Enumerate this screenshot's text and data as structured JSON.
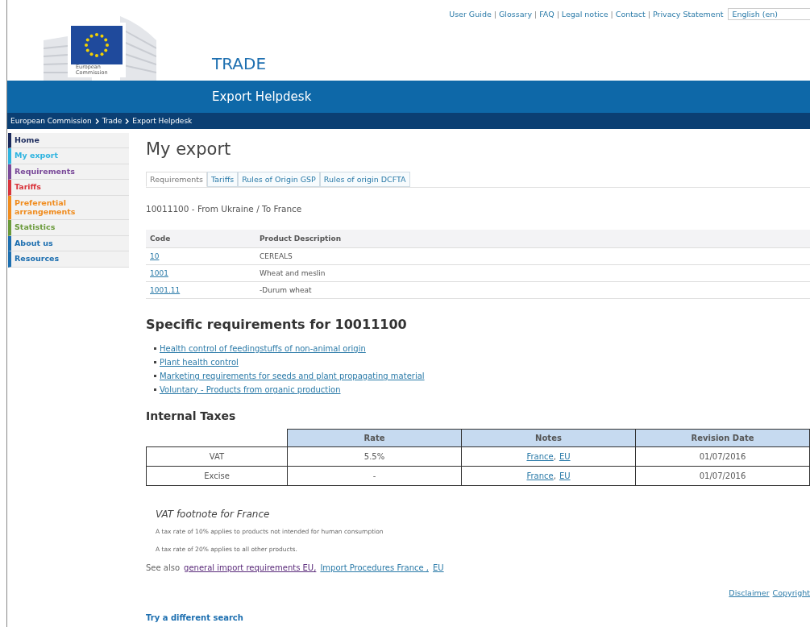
{
  "top_links": [
    "User Guide",
    "Glossary",
    "FAQ",
    "Legal notice",
    "Contact",
    "Privacy Statement"
  ],
  "top_link_separator": "|",
  "language": {
    "value": "English (en)"
  },
  "logo": {
    "caption": "European Commission"
  },
  "site": {
    "title": "TRADE",
    "subtitle": "Export Helpdesk"
  },
  "breadcrumb": [
    "European Commission",
    "Trade",
    "Export Helpdesk"
  ],
  "sidebar": {
    "items": [
      {
        "label": "Home",
        "color": "#1b2a5c"
      },
      {
        "label": "My export",
        "color": "#2fb4e0"
      },
      {
        "label": "Requirements",
        "color": "#7a4a9a"
      },
      {
        "label": "Tariffs",
        "color": "#d9343c"
      },
      {
        "label": "Preferential arrangements",
        "color": "#f08c1e"
      },
      {
        "label": "Statistics",
        "color": "#6a9a3a"
      },
      {
        "label": "About us",
        "color": "#1d6fb0"
      },
      {
        "label": "Resources",
        "color": "#1d6fb0"
      }
    ]
  },
  "page": {
    "title": "My export"
  },
  "tabs": [
    {
      "label": "Requirements",
      "selected": true
    },
    {
      "label": "Tariffs",
      "selected": false
    },
    {
      "label": "Rules of Origin GSP",
      "selected": false
    },
    {
      "label": "Rules of origin DCFTA",
      "selected": false
    }
  ],
  "route": "10011100 - From Ukraine / To France",
  "product_table": {
    "columns": [
      "Code",
      "Product Description"
    ],
    "rows": [
      {
        "code": "10",
        "description": "CEREALS"
      },
      {
        "code": "1001",
        "description": "Wheat and meslin"
      },
      {
        "code": "1001.11",
        "description": "-Durum wheat"
      }
    ]
  },
  "requirements": {
    "heading": "Specific requirements for 10011100",
    "links": [
      "Health control of feedingstuffs of non-animal origin",
      "Plant health control",
      "Marketing requirements for seeds and plant propagating material",
      "Voluntary - Products from organic production"
    ]
  },
  "taxes": {
    "heading": "Internal Taxes",
    "columns": [
      "Rate",
      "Notes",
      "Revision Date"
    ],
    "rows": [
      {
        "tax": "VAT",
        "rate": "5.5%",
        "notes": [
          "France",
          "EU"
        ],
        "notes_separator": ",",
        "revision_date": "01/07/2016"
      },
      {
        "tax": "Excise",
        "rate": "-",
        "notes": [
          "France",
          "EU"
        ],
        "notes_separator": ",",
        "revision_date": "01/07/2016"
      }
    ]
  },
  "footnote": {
    "title": "VAT footnote for France",
    "lines": [
      "A tax rate of 10% applies to products not intended for human consumption",
      "A tax rate of 20% applies to all other products."
    ]
  },
  "see_also": {
    "label": "See also",
    "links": [
      "general import requirements EU,",
      "Import Procedures France ,",
      "EU"
    ]
  },
  "footer_links": [
    "Disclaimer",
    "Copyright"
  ],
  "try_search": "Try a different search"
}
